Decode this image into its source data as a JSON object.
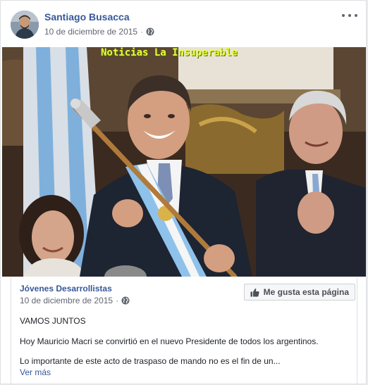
{
  "post": {
    "author_name": "Santiago Busacca",
    "date": "10 de diciembre de 2015",
    "separator": "·",
    "privacy_icon": "globe-icon",
    "more_icon": "more-options-icon"
  },
  "photo": {
    "watermark": "Noticias La Insuperable"
  },
  "shared_page": {
    "name": "Jóvenes Desarrollistas",
    "date": "10 de diciembre de 2015",
    "separator": "·",
    "like_page_label": "Me gusta esta página",
    "like_icon": "thumbs-up-icon",
    "text_lines": [
      "VAMOS JUNTOS",
      "Hoy Mauricio Macri se convirtió en el nuevo Presidente de todos los argentinos.",
      "Lo importante de este acto de traspaso de mando no es el fin de un..."
    ],
    "see_more": "Ver más"
  },
  "colors": {
    "link_blue": "#365899",
    "meta_gray": "#616770",
    "border": "#dddfe2",
    "watermark_yellow": "#e6ff3c"
  }
}
